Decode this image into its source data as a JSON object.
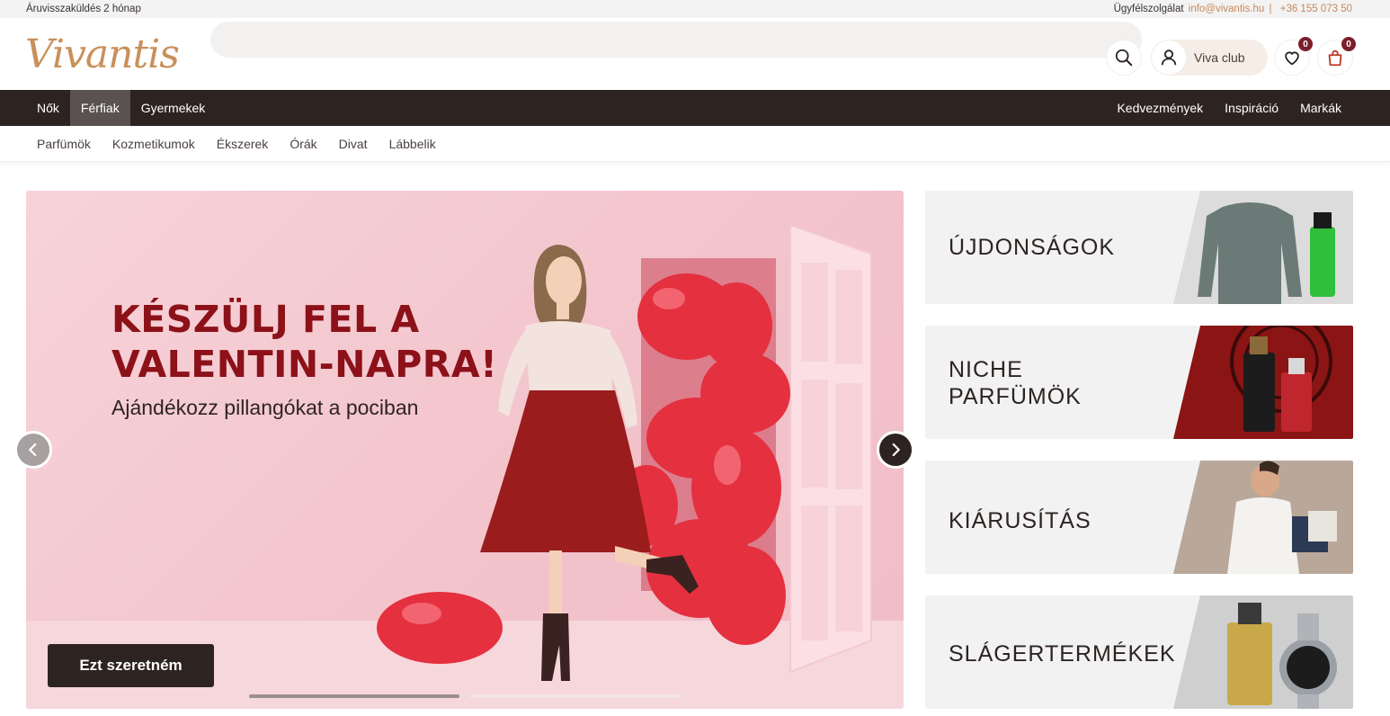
{
  "topbar": {
    "shipping": "Áruvisszaküldés 2 hónap",
    "support_label": "Ügyfélszolgálat",
    "email": "info@vivantis.hu",
    "separator": "|",
    "phone": "+36 155 073 50"
  },
  "header": {
    "logo": "Vivantis",
    "search_placeholder": "",
    "viva_club": "Viva club",
    "wishlist_count": "0",
    "cart_count": "0"
  },
  "mainnav": {
    "left": [
      "Nők",
      "Férfiak",
      "Gyermekek"
    ],
    "active": "Férfiak",
    "right": [
      "Kedvezmények",
      "Inspiráció",
      "Markák"
    ]
  },
  "subnav": [
    "Parfümök",
    "Kozmetikumok",
    "Ékszerek",
    "Órák",
    "Divat",
    "Lábbelik"
  ],
  "hero": {
    "title_line1": "KÉSZÜLJ FEL A",
    "title_line2": "VALENTIN-NAPRA!",
    "subtitle": "Ajándékozz pillangókat a pociban",
    "cta": "Ezt szeretném",
    "slide_progress": 0.5
  },
  "side_banners": [
    {
      "label": "ÚJDONSÁGOK"
    },
    {
      "label_line1": "NICHE",
      "label_line2": "PARFÜMÖK"
    },
    {
      "label": "KIÁRUSÍTÁS"
    },
    {
      "label": "SLÁGERTERMÉKEK"
    }
  ],
  "colors": {
    "brand": "#c9905b",
    "dark": "#2d2422",
    "hero_text": "#8c1119",
    "badge": "#7a1f2b"
  }
}
